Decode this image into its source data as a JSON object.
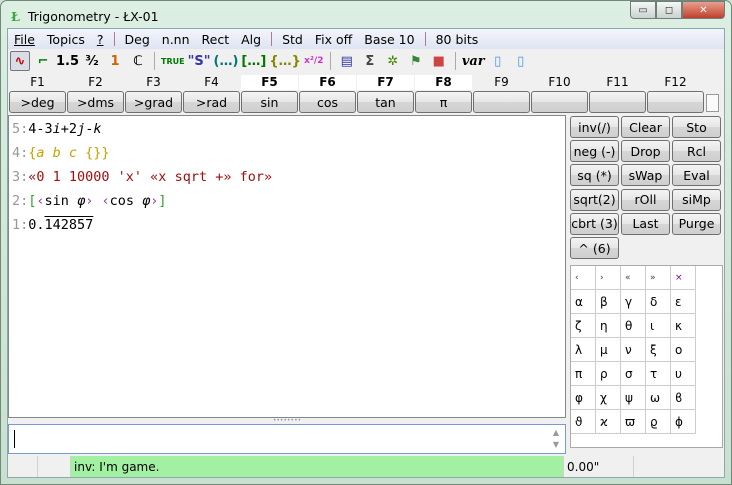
{
  "window": {
    "title": "Trigonometry - ŁX-01",
    "icon": "Ł",
    "minimize": "▭",
    "maximize": "◻",
    "close": "✕"
  },
  "menu": {
    "items": [
      "File",
      "Topics",
      "?"
    ],
    "modes": [
      "Deg",
      "n.nn",
      "Rect",
      "Alg"
    ],
    "modes2": [
      "Std",
      "Fix off",
      "Base 10"
    ],
    "bits": "80 bits"
  },
  "toolbar": {
    "items": [
      {
        "icon": "graph-icon",
        "text": "∿"
      },
      {
        "icon": "plot-icon",
        "text": "⌐"
      },
      {
        "icon": "decimal-icon",
        "text": "1.5"
      },
      {
        "icon": "fraction-icon",
        "text": "³⁄₂"
      },
      {
        "icon": "integer-icon",
        "text": "1"
      },
      {
        "icon": "complex-icon",
        "text": "ℂ"
      },
      {
        "icon": "boolean-icon",
        "text": "TRUE"
      },
      {
        "icon": "string-icon",
        "text": "\"S\""
      },
      {
        "icon": "program-icon",
        "text": "(…)"
      },
      {
        "icon": "vector-icon",
        "text": "[…]"
      },
      {
        "icon": "list-icon",
        "text": "{…}"
      },
      {
        "icon": "expression-icon",
        "text": "x²/2"
      },
      {
        "icon": "stack-icon",
        "text": "▤"
      },
      {
        "icon": "sum-icon",
        "text": "Σ"
      },
      {
        "icon": "tree-icon",
        "text": "✲"
      },
      {
        "icon": "flag-icon",
        "text": "⚑"
      },
      {
        "icon": "cube-icon",
        "text": "■"
      },
      {
        "icon": "var-icon",
        "text": "var"
      },
      {
        "icon": "document-icon",
        "text": "▯"
      },
      {
        "icon": "document-icon",
        "text": "▯"
      }
    ]
  },
  "fkeys": [
    {
      "key": "F1",
      "label": ">deg"
    },
    {
      "key": "F2",
      "label": ">dms"
    },
    {
      "key": "F3",
      "label": ">grad"
    },
    {
      "key": "F4",
      "label": ">rad"
    },
    {
      "key": "F5",
      "label": "sin"
    },
    {
      "key": "F6",
      "label": "cos"
    },
    {
      "key": "F7",
      "label": "tan"
    },
    {
      "key": "F8",
      "label": "π"
    },
    {
      "key": "F9",
      "label": ""
    },
    {
      "key": "F10",
      "label": ""
    },
    {
      "key": "F11",
      "label": ""
    },
    {
      "key": "F12",
      "label": ""
    }
  ],
  "stack": [
    {
      "n": "5:",
      "parts": [
        [
          "4-3",
          "#000"
        ],
        [
          "i",
          "#000",
          1
        ],
        [
          "+2",
          "#000"
        ],
        [
          "j",
          "#000",
          1
        ],
        [
          "-",
          "#000"
        ],
        [
          "k",
          "#000",
          1
        ]
      ]
    },
    {
      "n": "4:",
      "parts": [
        [
          "{",
          "#c8a000"
        ],
        [
          "a b c",
          "#c8a000",
          1
        ],
        [
          " {}}",
          "#c8a000"
        ]
      ]
    },
    {
      "n": "3:",
      "parts": [
        [
          "«0 1 10000 'x' «x sqrt +» for»",
          "#a01010"
        ]
      ]
    },
    {
      "n": "2:",
      "parts": [
        [
          "[",
          "#30a030"
        ],
        [
          "‹",
          "#a030a0"
        ],
        [
          "sin ",
          "#000"
        ],
        [
          "φ",
          "#000",
          1
        ],
        [
          "›",
          "#a030a0"
        ],
        [
          " ",
          "#000"
        ],
        [
          "‹",
          "#a030a0"
        ],
        [
          "cos ",
          "#000"
        ],
        [
          "φ",
          "#000",
          1
        ],
        [
          "›",
          "#a030a0"
        ],
        [
          "]",
          "#30a030"
        ]
      ]
    },
    {
      "n": "1:",
      "parts": [
        [
          "0.",
          "#000"
        ],
        [
          "142857",
          "#000",
          0,
          1
        ]
      ]
    }
  ],
  "keypad": [
    [
      "inv(/)",
      "Clear",
      "Sto"
    ],
    [
      "neg (-)",
      "Drop",
      "Rcl"
    ],
    [
      "sq (*)",
      "sWap",
      "Eval"
    ],
    [
      "sqrt(2)",
      "rOll",
      "siMp"
    ],
    [
      "cbrt (3)",
      "Last",
      "Purge"
    ],
    [
      "^ (6)"
    ]
  ],
  "chars": [
    [
      "‹",
      "›",
      "«",
      "»",
      "×"
    ],
    [
      "α",
      "β",
      "γ",
      "δ",
      "ε"
    ],
    [
      "ζ",
      "η",
      "θ",
      "ι",
      "κ"
    ],
    [
      "λ",
      "μ",
      "ν",
      "ξ",
      "ο"
    ],
    [
      "π",
      "ρ",
      "σ",
      "τ",
      "υ"
    ],
    [
      "φ",
      "χ",
      "ψ",
      "ω",
      "ϐ"
    ],
    [
      "ϑ",
      "ϰ",
      "ϖ",
      "ϱ",
      "ϕ"
    ]
  ],
  "input": {
    "value": ""
  },
  "status": {
    "message": "inv: I'm game.",
    "time": "0.00\""
  }
}
